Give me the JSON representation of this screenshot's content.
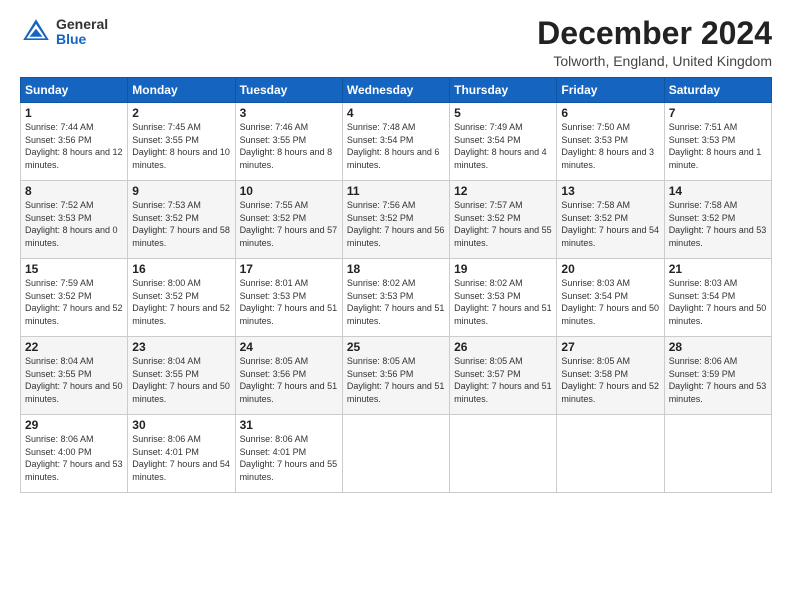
{
  "logo": {
    "general": "General",
    "blue": "Blue"
  },
  "title": "December 2024",
  "location": "Tolworth, England, United Kingdom",
  "days_of_week": [
    "Sunday",
    "Monday",
    "Tuesday",
    "Wednesday",
    "Thursday",
    "Friday",
    "Saturday"
  ],
  "weeks": [
    [
      {
        "day": "1",
        "sunrise": "7:44 AM",
        "sunset": "3:56 PM",
        "daylight": "8 hours and 12 minutes."
      },
      {
        "day": "2",
        "sunrise": "7:45 AM",
        "sunset": "3:55 PM",
        "daylight": "8 hours and 10 minutes."
      },
      {
        "day": "3",
        "sunrise": "7:46 AM",
        "sunset": "3:55 PM",
        "daylight": "8 hours and 8 minutes."
      },
      {
        "day": "4",
        "sunrise": "7:48 AM",
        "sunset": "3:54 PM",
        "daylight": "8 hours and 6 minutes."
      },
      {
        "day": "5",
        "sunrise": "7:49 AM",
        "sunset": "3:54 PM",
        "daylight": "8 hours and 4 minutes."
      },
      {
        "day": "6",
        "sunrise": "7:50 AM",
        "sunset": "3:53 PM",
        "daylight": "8 hours and 3 minutes."
      },
      {
        "day": "7",
        "sunrise": "7:51 AM",
        "sunset": "3:53 PM",
        "daylight": "8 hours and 1 minute."
      }
    ],
    [
      {
        "day": "8",
        "sunrise": "7:52 AM",
        "sunset": "3:53 PM",
        "daylight": "8 hours and 0 minutes."
      },
      {
        "day": "9",
        "sunrise": "7:53 AM",
        "sunset": "3:52 PM",
        "daylight": "7 hours and 58 minutes."
      },
      {
        "day": "10",
        "sunrise": "7:55 AM",
        "sunset": "3:52 PM",
        "daylight": "7 hours and 57 minutes."
      },
      {
        "day": "11",
        "sunrise": "7:56 AM",
        "sunset": "3:52 PM",
        "daylight": "7 hours and 56 minutes."
      },
      {
        "day": "12",
        "sunrise": "7:57 AM",
        "sunset": "3:52 PM",
        "daylight": "7 hours and 55 minutes."
      },
      {
        "day": "13",
        "sunrise": "7:58 AM",
        "sunset": "3:52 PM",
        "daylight": "7 hours and 54 minutes."
      },
      {
        "day": "14",
        "sunrise": "7:58 AM",
        "sunset": "3:52 PM",
        "daylight": "7 hours and 53 minutes."
      }
    ],
    [
      {
        "day": "15",
        "sunrise": "7:59 AM",
        "sunset": "3:52 PM",
        "daylight": "7 hours and 52 minutes."
      },
      {
        "day": "16",
        "sunrise": "8:00 AM",
        "sunset": "3:52 PM",
        "daylight": "7 hours and 52 minutes."
      },
      {
        "day": "17",
        "sunrise": "8:01 AM",
        "sunset": "3:53 PM",
        "daylight": "7 hours and 51 minutes."
      },
      {
        "day": "18",
        "sunrise": "8:02 AM",
        "sunset": "3:53 PM",
        "daylight": "7 hours and 51 minutes."
      },
      {
        "day": "19",
        "sunrise": "8:02 AM",
        "sunset": "3:53 PM",
        "daylight": "7 hours and 51 minutes."
      },
      {
        "day": "20",
        "sunrise": "8:03 AM",
        "sunset": "3:54 PM",
        "daylight": "7 hours and 50 minutes."
      },
      {
        "day": "21",
        "sunrise": "8:03 AM",
        "sunset": "3:54 PM",
        "daylight": "7 hours and 50 minutes."
      }
    ],
    [
      {
        "day": "22",
        "sunrise": "8:04 AM",
        "sunset": "3:55 PM",
        "daylight": "7 hours and 50 minutes."
      },
      {
        "day": "23",
        "sunrise": "8:04 AM",
        "sunset": "3:55 PM",
        "daylight": "7 hours and 50 minutes."
      },
      {
        "day": "24",
        "sunrise": "8:05 AM",
        "sunset": "3:56 PM",
        "daylight": "7 hours and 51 minutes."
      },
      {
        "day": "25",
        "sunrise": "8:05 AM",
        "sunset": "3:56 PM",
        "daylight": "7 hours and 51 minutes."
      },
      {
        "day": "26",
        "sunrise": "8:05 AM",
        "sunset": "3:57 PM",
        "daylight": "7 hours and 51 minutes."
      },
      {
        "day": "27",
        "sunrise": "8:05 AM",
        "sunset": "3:58 PM",
        "daylight": "7 hours and 52 minutes."
      },
      {
        "day": "28",
        "sunrise": "8:06 AM",
        "sunset": "3:59 PM",
        "daylight": "7 hours and 53 minutes."
      }
    ],
    [
      {
        "day": "29",
        "sunrise": "8:06 AM",
        "sunset": "4:00 PM",
        "daylight": "7 hours and 53 minutes."
      },
      {
        "day": "30",
        "sunrise": "8:06 AM",
        "sunset": "4:01 PM",
        "daylight": "7 hours and 54 minutes."
      },
      {
        "day": "31",
        "sunrise": "8:06 AM",
        "sunset": "4:01 PM",
        "daylight": "7 hours and 55 minutes."
      },
      null,
      null,
      null,
      null
    ]
  ]
}
